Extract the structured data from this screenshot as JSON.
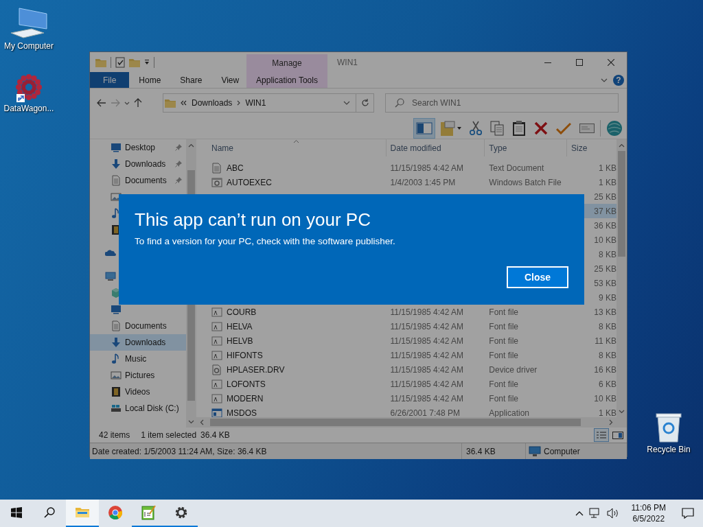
{
  "desktop_icons": [
    {
      "kind": "computer",
      "label": "My Computer",
      "shortcut": false
    },
    {
      "kind": "starburst",
      "label": "DataWagon...",
      "shortcut": true
    },
    {
      "kind": "recycle",
      "label": "Recycle Bin",
      "shortcut": false
    }
  ],
  "explorer": {
    "title": "WIN1",
    "contextual": {
      "group": "Manage",
      "tab": "Application Tools"
    },
    "ribbon_tabs": [
      {
        "kind": "file",
        "label": "File"
      },
      {
        "kind": "tab",
        "label": "Home"
      },
      {
        "kind": "tab",
        "label": "Share"
      },
      {
        "kind": "tab",
        "label": "View"
      }
    ],
    "help": "?",
    "address": [
      "Downloads",
      "WIN1"
    ],
    "search": {
      "placeholder": "Search WIN1"
    },
    "toolbar": [
      {
        "kind": "preview",
        "selected": true
      },
      {
        "kind": "properties",
        "selected": false
      },
      {
        "kind": "cut",
        "selected": false
      },
      {
        "kind": "copy",
        "selected": false
      },
      {
        "kind": "paste",
        "selected": false
      },
      {
        "kind": "delete",
        "selected": false
      },
      {
        "kind": "check",
        "selected": false
      },
      {
        "kind": "rename",
        "selected": false
      },
      {
        "kind": "shell",
        "selected": false
      }
    ],
    "nav_items": [
      {
        "kind": "desktop",
        "label": "Desktop",
        "pinned": true,
        "selected": false
      },
      {
        "kind": "download",
        "label": "Downloads",
        "pinned": true,
        "selected": false
      },
      {
        "kind": "document",
        "label": "Documents",
        "pinned": true,
        "selected": false
      },
      {
        "kind": "pictures",
        "selected": false
      },
      {
        "kind": "music",
        "selected": false
      },
      {
        "kind": "videos",
        "selected": false
      },
      {
        "kind": "onedrive",
        "selected": false
      },
      {
        "kind": "thispc",
        "selected": false
      },
      {
        "kind": "objects3d",
        "selected": false
      },
      {
        "kind": "desktop",
        "selected": false
      },
      {
        "kind": "document",
        "label": "Documents",
        "selected": false
      },
      {
        "kind": "download",
        "label": "Downloads",
        "selected": true
      },
      {
        "kind": "music",
        "label": "Music",
        "selected": false
      },
      {
        "kind": "pictures",
        "label": "Pictures",
        "selected": false
      },
      {
        "kind": "videos",
        "label": "Videos",
        "selected": false
      },
      {
        "kind": "disk",
        "label": "Local Disk (C:)",
        "selected": false
      }
    ],
    "columns": [
      "Name",
      "Date modified",
      "Type",
      "Size"
    ],
    "rows": [
      {
        "kind": "text",
        "name": "ABC",
        "date": "11/15/1985 4:42 AM",
        "type": "Text Document",
        "size": "1 KB",
        "selected": false
      },
      {
        "kind": "batch",
        "name": "AUTOEXEC",
        "date": "1/4/2003 1:45 PM",
        "type": "Windows Batch File",
        "size": "1 KB",
        "selected": false
      },
      {
        "size": "25 KB",
        "selected": false
      },
      {
        "size": "37 KB",
        "selected": true
      },
      {
        "size": "36 KB",
        "selected": false
      },
      {
        "size": "10 KB",
        "selected": false
      },
      {
        "size": "8 KB",
        "selected": false
      },
      {
        "size": "25 KB",
        "selected": false
      },
      {
        "size": "53 KB",
        "selected": false
      },
      {
        "size": "9 KB",
        "selected": false
      },
      {
        "kind": "font",
        "name": "COURB",
        "date": "11/15/1985 4:42 AM",
        "type": "Font file",
        "size": "13 KB",
        "selected": false
      },
      {
        "kind": "font",
        "name": "HELVA",
        "date": "11/15/1985 4:42 AM",
        "type": "Font file",
        "size": "8 KB",
        "selected": false
      },
      {
        "kind": "font",
        "name": "HELVB",
        "date": "11/15/1985 4:42 AM",
        "type": "Font file",
        "size": "11 KB",
        "selected": false
      },
      {
        "kind": "font",
        "name": "HIFONTS",
        "date": "11/15/1985 4:42 AM",
        "type": "Font file",
        "size": "8 KB",
        "selected": false
      },
      {
        "kind": "driver",
        "name": "HPLASER.DRV",
        "date": "11/15/1985 4:42 AM",
        "type": "Device driver",
        "size": "16 KB",
        "selected": false
      },
      {
        "kind": "font",
        "name": "LOFONTS",
        "date": "11/15/1985 4:42 AM",
        "type": "Font file",
        "size": "6 KB",
        "selected": false
      },
      {
        "kind": "font",
        "name": "MODERN",
        "date": "11/15/1985 4:42 AM",
        "type": "Font file",
        "size": "10 KB",
        "selected": false
      },
      {
        "kind": "app",
        "name": "MSDOS",
        "date": "6/26/2001 7:48 PM",
        "type": "Application",
        "size": "1 KB",
        "selected": false
      }
    ],
    "status": {
      "count": "42 items",
      "selection": "1 item selected",
      "selection_size": "36.4 KB"
    },
    "views": [
      {
        "kind": "details",
        "selected": true
      },
      {
        "kind": "preview",
        "selected": false
      }
    ],
    "details_bar": {
      "info": "Date created: 1/5/2003 11:24 AM, Size: 36.4 KB",
      "size": "36.4 KB",
      "zone": "Computer"
    }
  },
  "dialog": {
    "title": "This app can’t run on your PC",
    "message": "To find a version for your PC, check with the software publisher.",
    "button": "Close"
  },
  "taskbar": {
    "apps": [
      {
        "kind": "explorer",
        "active": true,
        "running": true
      },
      {
        "kind": "chrome",
        "active": false,
        "running": false
      },
      {
        "kind": "notepad",
        "active": false,
        "running": true
      },
      {
        "kind": "settings",
        "active": false,
        "running": true
      }
    ],
    "time": "11:06 PM",
    "date": "6/5/2022"
  }
}
